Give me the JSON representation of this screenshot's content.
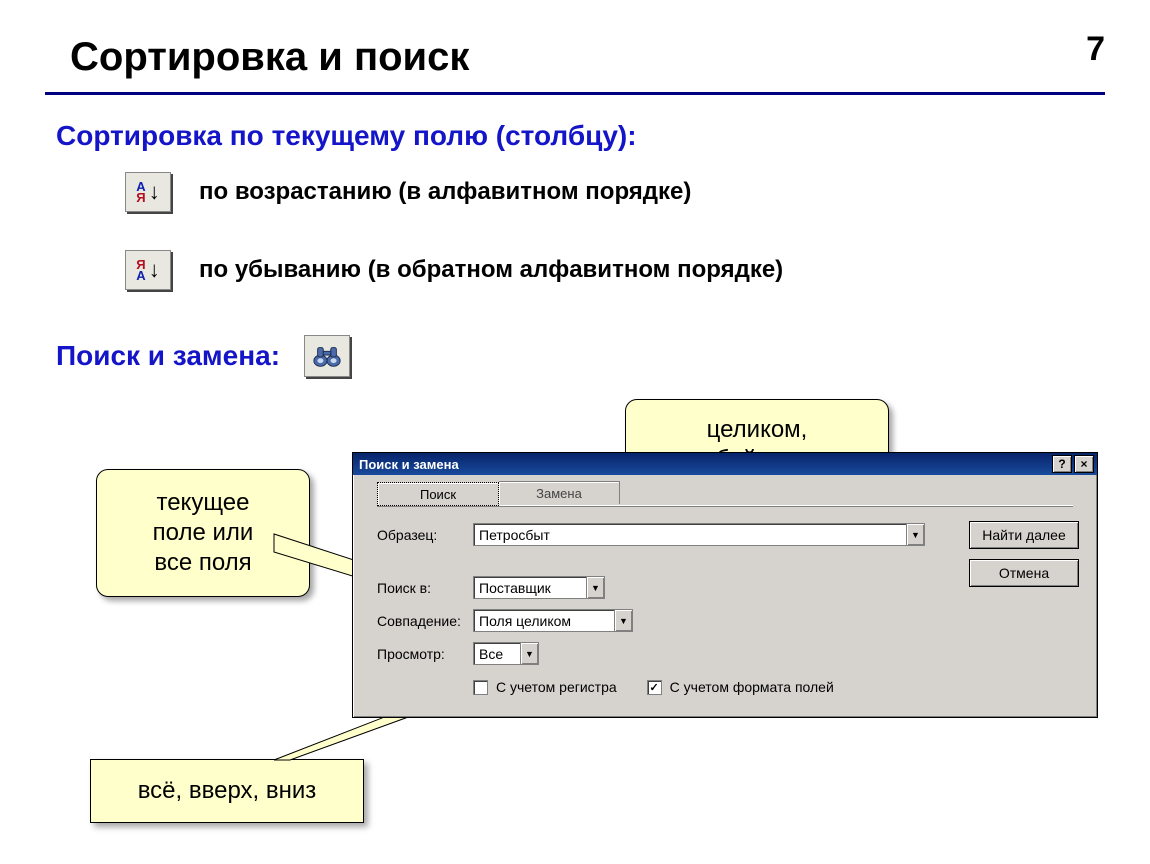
{
  "page_number": "7",
  "title": "Сортировка и поиск",
  "section_sort_title": "Сортировка по текущему полю (столбцу):",
  "sort_asc_label": "по возрастанию (в алфавитном порядке)",
  "sort_desc_label": "по убыванию (в обратном алфавитном порядке)",
  "section_find_title": "Поиск и замена:",
  "callouts": {
    "match_type": "целиком,\nс любой частью,\nс началом",
    "field_scope": "текущее\nполе или\nвсе поля",
    "direction": "всё, вверх, вниз"
  },
  "dialog": {
    "title": "Поиск и замена",
    "tabs": {
      "find": "Поиск",
      "replace": "Замена"
    },
    "labels": {
      "sample": "Образец:",
      "search_in": "Поиск в:",
      "match": "Совпадение:",
      "look": "Просмотр:"
    },
    "values": {
      "sample": "Петросбыт",
      "search_in": "Поставщик",
      "match": "Поля целиком",
      "look": "Все"
    },
    "buttons": {
      "find_next": "Найти далее",
      "cancel": "Отмена"
    },
    "checks": {
      "case": "С учетом регистра",
      "format": "С учетом формата полей"
    }
  }
}
